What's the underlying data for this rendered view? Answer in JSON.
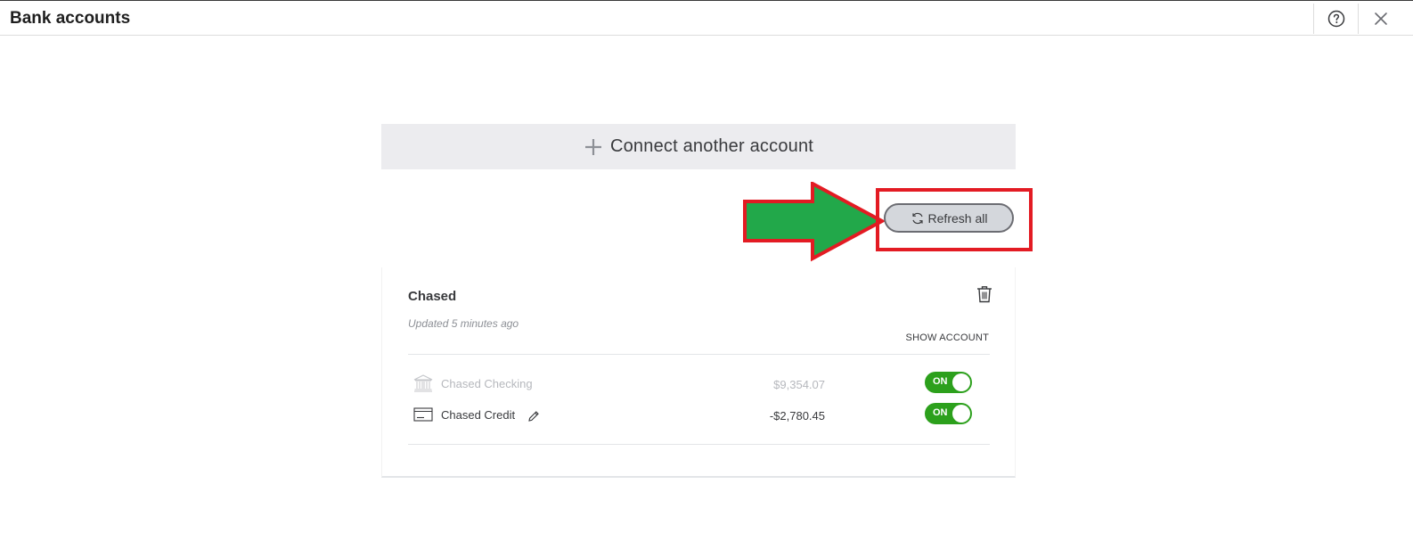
{
  "header": {
    "title": "Bank accounts",
    "help_icon": "help-circle-icon",
    "close_icon": "close-icon"
  },
  "connect": {
    "label": "Connect another account",
    "icon": "plus-icon"
  },
  "refresh": {
    "label": "Refresh all",
    "icon": "refresh-icon"
  },
  "annotation": {
    "arrow_color": "#22a84a",
    "outline_color": "#e31b23"
  },
  "bank": {
    "name": "Chased",
    "updated": "Updated 5 minutes ago",
    "show_account_label": "SHOW ACCOUNT",
    "delete_icon": "trash-icon",
    "accounts": [
      {
        "name": "Chased Checking",
        "balance": "$9,354.07",
        "toggle": "ON",
        "icon": "bank-icon",
        "enabled_style": "faded"
      },
      {
        "name": "Chased Credit",
        "balance": "-$2,780.45",
        "toggle": "ON",
        "icon": "credit-card-icon",
        "edit_icon": "pencil-icon"
      }
    ]
  },
  "colors": {
    "toggle_on": "#2ca01c",
    "connect_bg": "#ececef",
    "refresh_bg": "#d4d7dc"
  }
}
